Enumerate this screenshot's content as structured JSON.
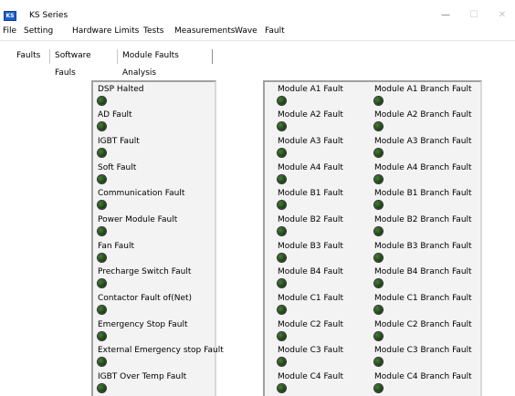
{
  "window": {
    "title": "KS Series",
    "icon_label": "KS",
    "minimize_glyph": "—",
    "maximize_glyph": "☐",
    "close_glyph": "✕"
  },
  "menu": [
    "File",
    "Setting",
    "Hardware Limits",
    "Tests",
    "Measurements",
    "Wave",
    "Fault"
  ],
  "tabs": [
    {
      "label": "Faults",
      "active": true
    },
    {
      "label": "Software Fauls",
      "active": false
    },
    {
      "label": "Module Faults Analysis",
      "active": false
    }
  ],
  "left_faults": [
    "DSP Halted",
    "AD Fault",
    "IGBT Fault",
    "Soft Fault",
    "Communication Fault",
    "Power Module Fault",
    "Fan Fault",
    "Precharge Switch Fault",
    "Contactor Fault of(Net)",
    "Emergency Stop Fault",
    "External Emergency stop Fault",
    "IGBT Over Temp Fault"
  ],
  "module_faults": [
    "Module A1 Fault",
    "Module A2 Fault",
    "Module A3 Fault",
    "Module A4 Fault",
    "Module B1 Fault",
    "Module B2 Fault",
    "Module B3 Fault",
    "Module B4 Fault",
    "Module C1 Fault",
    "Module C2 Fault",
    "Module C3 Fault",
    "Module C4 Fault"
  ],
  "branch_faults": [
    "Module A1 Branch Fault",
    "Module A2 Branch Fault",
    "Module A3 Branch Fault",
    "Module A4 Branch Fault",
    "Module B1 Branch Fault",
    "Module B2 Branch Fault",
    "Module B3 Branch Fault",
    "Module B4 Branch Fault",
    "Module C1 Branch Fault",
    "Module C2 Branch Fault",
    "Module C3 Branch Fault",
    "Module C4 Branch Fault"
  ],
  "indicator_state": "off",
  "colors": {
    "led_off": "#1f4a16",
    "panel_bg": "#f3f3f3",
    "app_icon": "#1e5ec8"
  }
}
